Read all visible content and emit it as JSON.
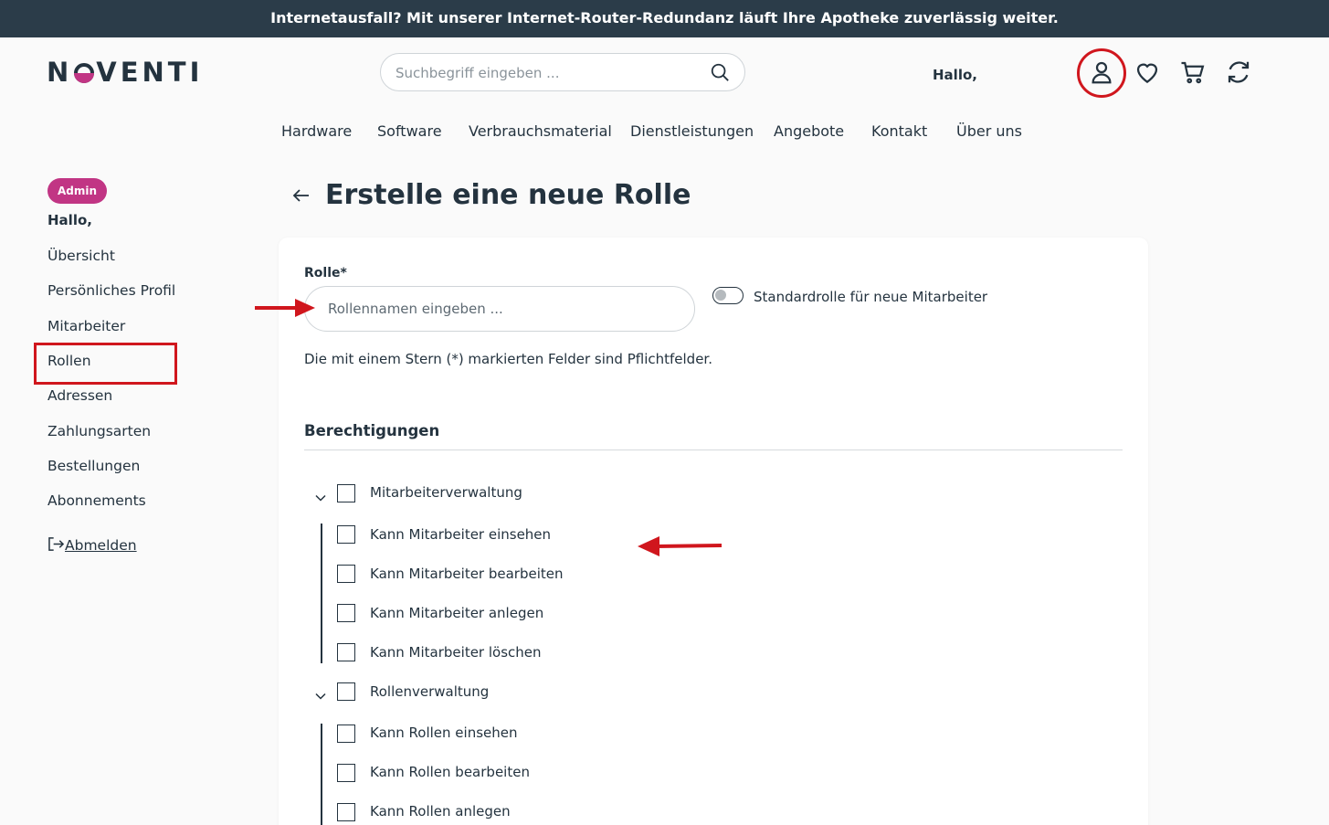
{
  "banner": {
    "text": "Internetausfall? Mit unserer Internet-Router-Redundanz läuft Ihre Apotheke zuverlässig weiter."
  },
  "header": {
    "logo_pre": "N",
    "logo_post": "VENTI",
    "search_placeholder": "Suchbegriff eingeben ...",
    "greeting": "Hallo,"
  },
  "nav": {
    "items": [
      "Hardware",
      "Software",
      "Verbrauchsmaterial",
      "Dienstleistungen",
      "Angebote",
      "Kontakt",
      "Über uns"
    ]
  },
  "sidebar": {
    "badge": "Admin",
    "greeting": "Hallo,",
    "items": [
      "Übersicht",
      "Persönliches Profil",
      "Mitarbeiter",
      "Rollen",
      "Adressen",
      "Zahlungsarten",
      "Bestellungen",
      "Abonnements"
    ],
    "logout": "Abmelden"
  },
  "page": {
    "title": "Erstelle eine neue Rolle"
  },
  "form": {
    "role_label": "Rolle*",
    "role_placeholder": "Rollennamen eingeben ...",
    "toggle_label": "Standardrolle für neue Mitarbeiter",
    "required_note": "Die mit einem Stern (*) markierten Felder sind Pflichtfelder.",
    "permissions_title": "Berechtigungen",
    "groups": [
      {
        "label": "Mitarbeiterverwaltung",
        "items": [
          "Kann Mitarbeiter einsehen",
          "Kann Mitarbeiter bearbeiten",
          "Kann Mitarbeiter anlegen",
          "Kann Mitarbeiter löschen"
        ]
      },
      {
        "label": "Rollenverwaltung",
        "items": [
          "Kann Rollen einsehen",
          "Kann Rollen bearbeiten",
          "Kann Rollen anlegen"
        ]
      }
    ]
  },
  "colors": {
    "banner_bg": "#2b3c49",
    "brand_magenta": "#c13584",
    "text": "#24333f",
    "annotation_red": "#d0161d"
  }
}
